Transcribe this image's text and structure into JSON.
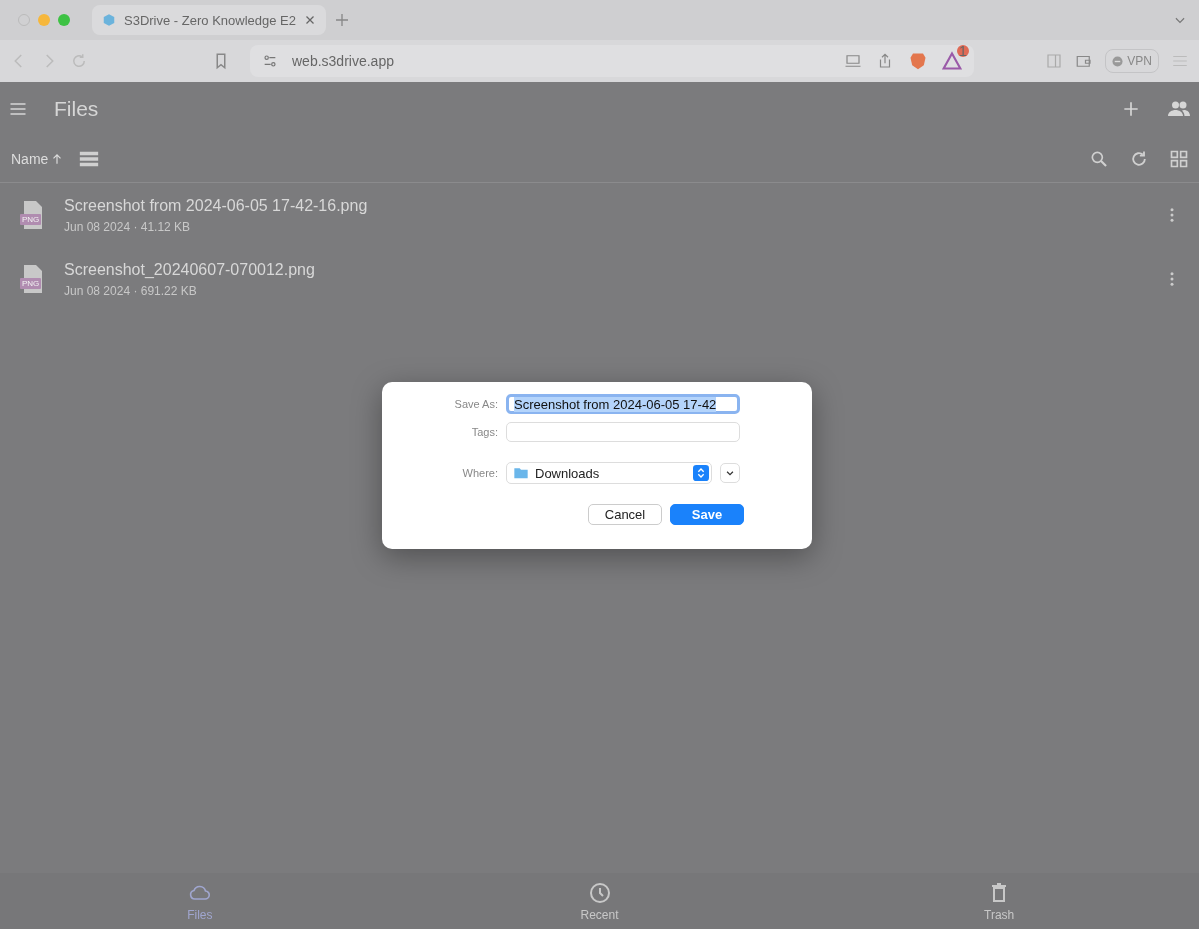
{
  "browser": {
    "tab": {
      "title": "S3Drive - Zero Knowledge E2"
    },
    "address": "web.s3drive.app",
    "rewards_badge": "1",
    "vpn_label": "VPN"
  },
  "app": {
    "title": "Files",
    "sort": {
      "label": "Name"
    },
    "files": [
      {
        "name": "Screenshot from 2024-06-05 17-42-16.png",
        "meta": "Jun 08 2024 · 41.12 KB",
        "type_label": "PNG"
      },
      {
        "name": "Screenshot_20240607-070012.png",
        "meta": "Jun 08 2024 · 691.22 KB",
        "type_label": "PNG"
      }
    ],
    "nav": [
      {
        "label": "Files",
        "kind": "cloud",
        "selected": true
      },
      {
        "label": "Recent",
        "kind": "clock",
        "selected": false
      },
      {
        "label": "Trash",
        "kind": "trash",
        "selected": false
      }
    ]
  },
  "dialog": {
    "save_as_label": "Save As:",
    "save_as_value": "Screenshot from 2024-06-05 17-42",
    "tags_label": "Tags:",
    "where_label": "Where:",
    "where_value": "Downloads",
    "buttons": [
      {
        "label": "Cancel",
        "kind": "secondary"
      },
      {
        "label": "Save",
        "kind": "primary"
      }
    ]
  }
}
